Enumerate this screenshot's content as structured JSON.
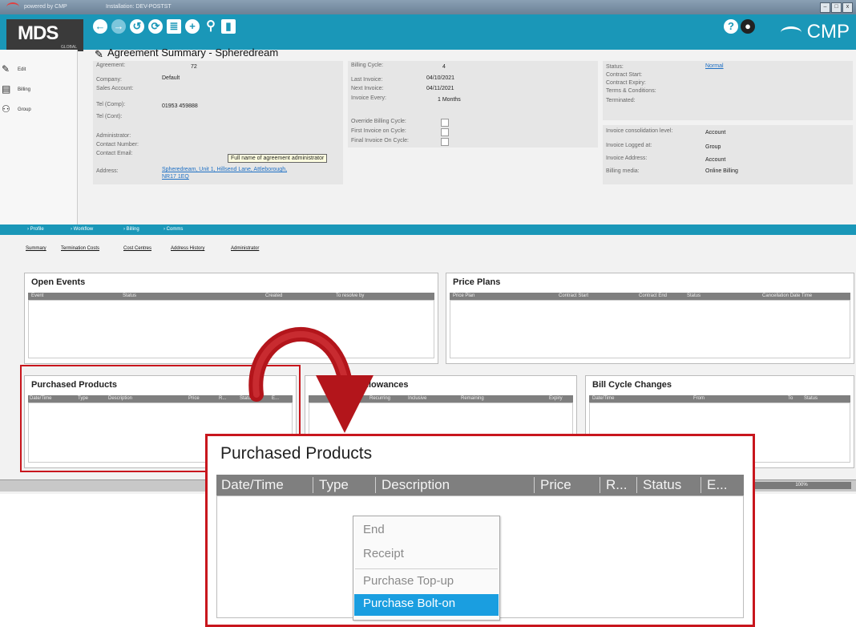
{
  "window": {
    "powered_by": "powered by CMP",
    "installation": "Installation: DEV-POSTST",
    "min": "–",
    "max": "□",
    "close": "x"
  },
  "brand": {
    "logo": "MDS",
    "logo_sub": "GLOBAL",
    "right_logo": "CMP"
  },
  "toolbar": {
    "icons": [
      "back-icon",
      "forward-icon",
      "history-icon",
      "refresh-icon",
      "clipboard-icon",
      "add-icon",
      "search-icon",
      "document-icon"
    ]
  },
  "leftnav": [
    {
      "label": "Edit"
    },
    {
      "label": "Billing"
    },
    {
      "label": "Group"
    }
  ],
  "header": {
    "title": "Agreement Summary - Spheredream"
  },
  "agreement": {
    "agreement_label": "Agreement:",
    "agreement_value": "72",
    "company_label": "Company:",
    "company_value": "Default",
    "sales_label": "Sales Account:",
    "tel_comp_label": "Tel (Comp):",
    "tel_comp_value": "01953 459888",
    "tel_cont_label": "Tel (Cont):",
    "admin_label": "Administrator:",
    "contact_number_label": "Contact Number:",
    "contact_email_label": "Contact Email:",
    "address_label": "Address:",
    "address_value_1": "Spheredream, Unit 1, Hillsend Lane, Attleborough,",
    "address_value_2": "NR17 1EQ",
    "tooltip": "Full name of agreement administrator"
  },
  "billing": {
    "cycle_label": "Billing Cycle:",
    "cycle_value": "4",
    "last_label": "Last Invoice:",
    "last_value": "04/10/2021",
    "next_label": "Next Invoice:",
    "next_value": "04/11/2021",
    "every_label": "Invoice Every:",
    "every_value": "1 Months",
    "override_label": "Override Billing Cycle:",
    "first_label": "First Invoice on Cycle:",
    "final_label": "Final Invoice On Cycle:"
  },
  "status": {
    "status_label": "Status:",
    "status_value": "Normal",
    "contract_start_label": "Contract Start:",
    "contract_expiry_label": "Contract Expiry:",
    "terms_label": "Terms & Conditions:",
    "terminated_label": "Terminated:",
    "consolidation_label": "Invoice consolidation level:",
    "consolidation_value": "Account",
    "logged_label": "Invoice Logged at:",
    "logged_value": "Group",
    "address_label": "Invoice Address:",
    "address_value": "Account",
    "media_label": "Billing media:",
    "media_value": "Online Billing"
  },
  "tabs": [
    "Profile",
    "Workflow",
    "Billing",
    "Comms"
  ],
  "subtabs": [
    "Summary",
    "Termination Costs",
    "Cost Centres",
    "Address History",
    "Administrator"
  ],
  "open_events": {
    "title": "Open Events",
    "columns": [
      "Event",
      "Status",
      "Created",
      "To resolve by"
    ]
  },
  "price_plans": {
    "title": "Price Plans",
    "columns": [
      "Price Plan",
      "Contract Start",
      "Contract End",
      "Status",
      "Cancellation Date Time"
    ]
  },
  "purchased_products": {
    "title": "Purchased Products",
    "columns": [
      "Date/Time",
      "Type",
      "Description",
      "Price",
      "R...",
      "Status",
      "E..."
    ]
  },
  "allowances": {
    "title": "Allowances",
    "columns": [
      "Recurring",
      "Inclusive",
      "Remaining",
      "Expiry"
    ]
  },
  "bill_cycle_changes": {
    "title": "Bill Cycle Changes",
    "columns": [
      "Date/Time",
      "From",
      "To",
      "Status"
    ]
  },
  "statusbar": {
    "progress": "100%",
    "progress_value": 1.0
  },
  "zoom": {
    "title": "Purchased Products",
    "columns": [
      "Date/Time",
      "Type",
      "Description",
      "Price",
      "R...",
      "Status",
      "E..."
    ]
  },
  "context_menu": {
    "items": [
      "End",
      "Receipt",
      "Purchase Top-up",
      "Purchase Bolt-on"
    ],
    "highlighted": "Purchase Bolt-on"
  },
  "colors": {
    "accent": "#1a97b8",
    "highlight_red": "#c8161d",
    "menu_highlight": "#1a9ee0"
  }
}
